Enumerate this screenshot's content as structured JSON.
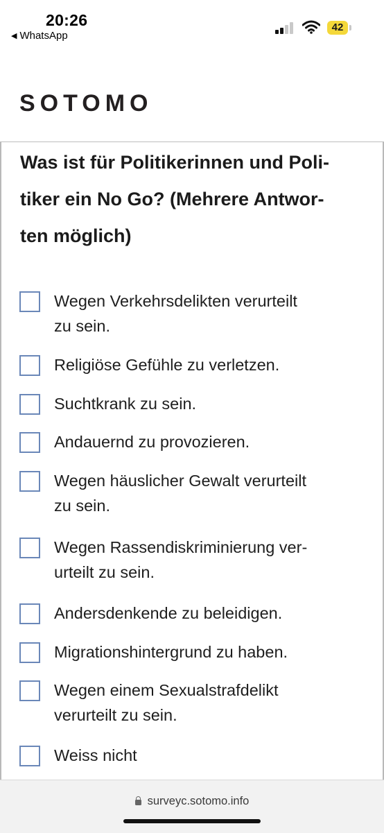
{
  "status_bar": {
    "time": "20:26",
    "back_app": "WhatsApp",
    "battery": "42",
    "battery_color": "#f4d83a"
  },
  "header": {
    "logo": "SOTOMO"
  },
  "question": {
    "lines": [
      "Was ist für Politikerinnen und Poli-",
      "tiker ein No Go? (Mehrere Antwor-",
      "ten möglich)"
    ]
  },
  "options": [
    {
      "lines": [
        "Wegen Verkehrsdelikten verurteilt",
        "zu sein."
      ],
      "checked": false
    },
    {
      "lines": [
        "Religiöse Gefühle zu verletzen."
      ],
      "checked": false
    },
    {
      "lines": [
        "Suchtkrank zu sein."
      ],
      "checked": false
    },
    {
      "lines": [
        "Andauernd zu provozieren."
      ],
      "checked": false
    },
    {
      "lines": [
        "Wegen häuslicher Gewalt verurteilt",
        "zu sein."
      ],
      "checked": false
    },
    {
      "lines": [
        "Wegen Rassendiskriminierung ver-",
        "urteilt zu sein."
      ],
      "checked": false
    },
    {
      "lines": [
        "Andersdenkende zu beleidigen."
      ],
      "checked": false
    },
    {
      "lines": [
        "Migrationshintergrund zu haben."
      ],
      "checked": false
    },
    {
      "lines": [
        "Wegen einem Sexualstrafdelikt",
        "verurteilt zu sein."
      ],
      "checked": false
    },
    {
      "lines": [
        "Weiss nicht"
      ],
      "checked": false
    }
  ],
  "browser": {
    "url": "surveyc.sotomo.info"
  },
  "colors": {
    "checkbox_border": "#6a87b8",
    "text": "#1e1e1e"
  }
}
